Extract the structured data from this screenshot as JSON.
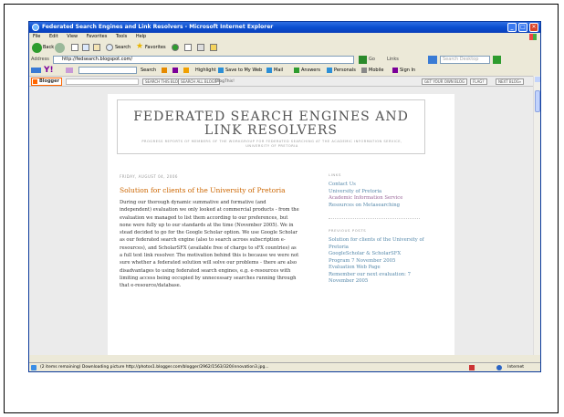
{
  "window": {
    "title": "Federated Search Engines and Link Resolvers - Microsoft Internet Explorer"
  },
  "menu": [
    "File",
    "Edit",
    "View",
    "Favorites",
    "Tools",
    "Help"
  ],
  "nav": {
    "back": "Back",
    "search": "Search",
    "favorites": "Favorites"
  },
  "address": {
    "label": "Address",
    "url": "http://fedsearch.blogspot.com/",
    "go": "Go",
    "links": "Links",
    "search_placeholder": "Search Desktop"
  },
  "yahoo_toolbar": {
    "search": "Search",
    "highlight": "Highlight",
    "save": "Save to My Web",
    "mail": "Mail",
    "answers": "Answers",
    "personals": "Personals",
    "mobile": "Mobile",
    "signin": "Sign In"
  },
  "blogger_bar": {
    "logo": "Blogger",
    "search_this": "SEARCH THIS BLOG",
    "search_all": "SEARCH ALL BLOGS",
    "blogthis": "BlogThis!",
    "get_own": "GET YOUR OWN BLOG",
    "flag": "FLAG?",
    "next": "NEXT BLOG»"
  },
  "blog": {
    "title_line1": "FEDERATED SEARCH ENGINES AND",
    "title_line2": "LINK RESOLVERS",
    "description": "PROGRESS REPORTS OF MEMBERS OF THE WORKGROUP FOR FEDERATED SEARCHING AT THE ACADEMIC INFORMATION SERVICE, UNIVERSITY OF PRETORIA"
  },
  "post": {
    "date": "FRIDAY, AUGUST 04, 2006",
    "title": "Solution for clients of the University of Pretoria",
    "body": "During our thorough dynamic summative and formative (and independent) evaluation we only looked at commercial products - from the evaluation we managed to list them according to our preferences, but none were fully up to our standards at the time (November 2005). We in stead decided to go for the Google Scholar option. We use Google Scholar as our federated search engine (also to search across subscription e-resources), and ScholarSFX (available free of charge to sFX countries) as a full text link resolver. The motivation behind this is because we were not sure whether a federated solution will solve our problems - there are also disadvantages to using federated search engines, e.g. e-resources with limiting access being occupied by unnecessary searches running through that e-resource/database."
  },
  "sidebar": {
    "links_heading": "LINKS",
    "links": [
      "Contact Us",
      "University of Pretoria",
      "Academic Information Service",
      "Resources on Metasearching"
    ],
    "previous_heading": "PREVIOUS POSTS",
    "previous": [
      "Solution for clients of the University of Pretoria",
      "GoogleScholar & ScholarSFX",
      "Program 7 November 2005",
      "Evaluation Web Page",
      "Remember our next evaluation: 7 November 2005"
    ]
  },
  "status": {
    "message": "(2 items remaining) Downloading picture http://photos1.blogger.com/blogger/2962/1563/320/innovation3.jpg...",
    "zone": "Internet"
  }
}
